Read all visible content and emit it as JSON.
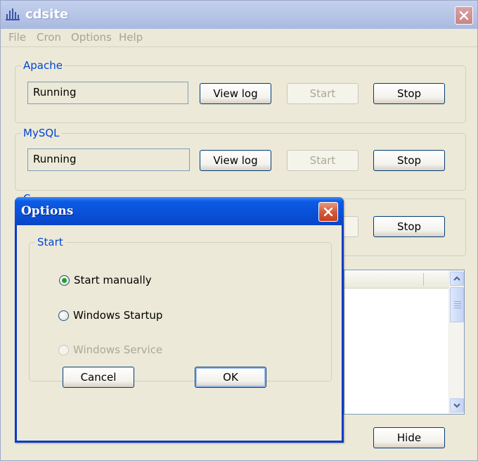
{
  "window": {
    "title": "cdsite"
  },
  "menu": {
    "file": "File",
    "cron": "Cron",
    "options": "Options",
    "help": "Help"
  },
  "apache": {
    "title": "Apache",
    "status": "Running",
    "view_log_label": "View log",
    "start_label": "Start",
    "stop_label": "Stop"
  },
  "mysql": {
    "title": "MySQL",
    "status": "Running",
    "view_log_label": "View log",
    "start_label": "Start",
    "stop_label": "Stop"
  },
  "cron": {
    "title": "C",
    "stop_label": "Stop"
  },
  "footer": {
    "hide_label": "Hide"
  },
  "dialog": {
    "title": "Options",
    "group_title": "Start",
    "options": [
      {
        "label": "Start manually",
        "selected": true,
        "enabled": true
      },
      {
        "label": "Windows Startup",
        "selected": false,
        "enabled": true
      },
      {
        "label": "Windows Service",
        "selected": false,
        "enabled": false
      }
    ],
    "cancel_label": "Cancel",
    "ok_label": "OK"
  },
  "colors": {
    "group_title": "#0046d5",
    "dialog_title_bar": "#0850d6",
    "radio_dot": "#21a121",
    "disabled_text": "#aca899"
  },
  "icons": {
    "app": "bar-chart-icon",
    "close": "close-icon",
    "scroll_up": "chevron-up-icon",
    "scroll_down": "chevron-down-icon"
  }
}
